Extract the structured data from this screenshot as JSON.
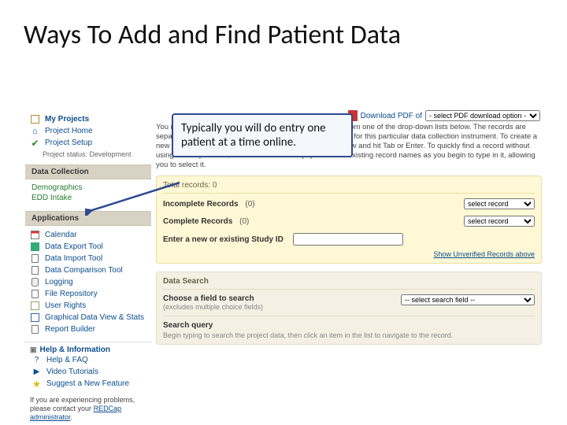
{
  "slide": {
    "title": "Ways To Add and Find Patient Data"
  },
  "callout": {
    "text": "Typically you will do entry one patient at a time online."
  },
  "sidebar": {
    "top": {
      "my_projects": "My Projects",
      "project_home": "Project Home",
      "project_setup": "Project Setup"
    },
    "status": "Project status: Development",
    "section_data_collection": "Data Collection",
    "dc_links": {
      "demographics": "Demographics",
      "edd_intake": "EDD Intake"
    },
    "section_applications": "Applications",
    "apps": {
      "calendar": "Calendar",
      "data_export": "Data Export Tool",
      "data_import": "Data Import Tool",
      "data_comparison": "Data Comparison Tool",
      "logging": "Logging",
      "file_repository": "File Repository",
      "user_rights": "User Rights",
      "gdv_stats": "Graphical Data View & Stats",
      "report_builder": "Report Builder"
    },
    "help_header": "Help & Information",
    "help": {
      "faq": "Help & FAQ",
      "videos": "Video Tutorials",
      "suggest": "Suggest a New Feature"
    },
    "help_note_pre": "If you are experiencing problems, please contact your ",
    "help_note_link": "REDCap administrator",
    "help_note_post": "."
  },
  "main": {
    "download_pdf_label": "Download PDF of",
    "download_select_placeholder": "- select PDF download option -",
    "intro": "You may view an existing record/response by selecting it from one of the drop-down lists below. The records are separated into each drop-down list according to their status for this particular data collection instrument. To create a new record/response, type a new value in the text box below and hit Tab or Enter. To quickly find a record without using the drop-downs, the text box will auto-populate with existing record names as you begin to type in it, allowing you to select it.",
    "total_records_label": "Total records:",
    "total_records_value": "0",
    "incomplete_label": "Incomplete Records",
    "incomplete_count": "(0)",
    "complete_label": "Complete Records",
    "complete_count": "(0)",
    "select_record_placeholder": "select record",
    "study_id_label": "Enter a new or existing Study ID",
    "show_unverified": "Show Unverified Records above",
    "data_search_title": "Data Search",
    "choose_field_label": "Choose a field to search",
    "choose_field_sub": "(excludes multiple choice fields)",
    "choose_field_placeholder": "-- select search field --",
    "search_query_label": "Search query",
    "search_query_sub": "Begin typing to search the project data, then click an item in the list to navigate to the record."
  }
}
